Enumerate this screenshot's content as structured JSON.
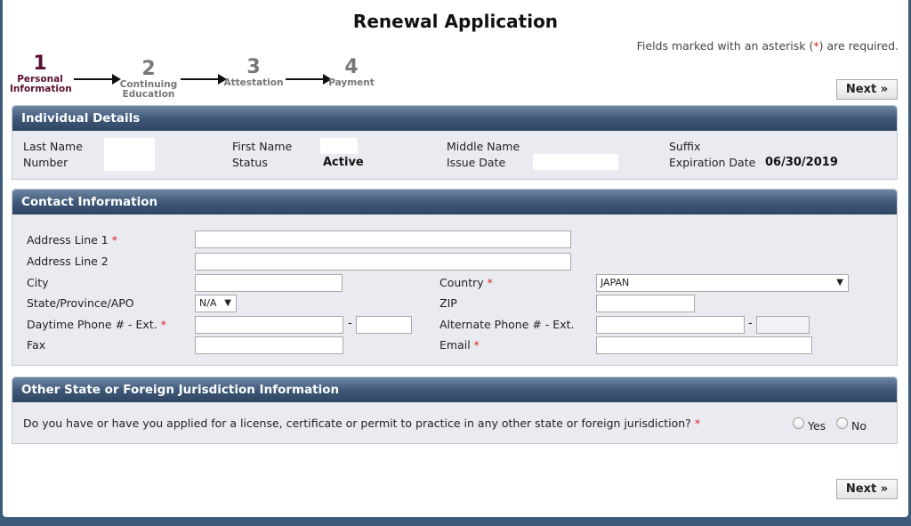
{
  "page": {
    "title": "Renewal Application",
    "required_note_pre": "Fields marked with an asterisk (",
    "required_note_star": "*",
    "required_note_post": ") are required."
  },
  "steps": [
    {
      "num": "1",
      "label_line1": "Personal",
      "label_line2": "Information",
      "active": true
    },
    {
      "num": "2",
      "label_line1": "Continuing",
      "label_line2": "Education",
      "active": false
    },
    {
      "num": "3",
      "label_line1": "Attestation",
      "label_line2": "",
      "active": false
    },
    {
      "num": "4",
      "label_line1": "Payment",
      "label_line2": "",
      "active": false
    }
  ],
  "next_button": "Next »",
  "individual": {
    "heading": "Individual Details",
    "last_name_label": "Last Name",
    "number_label": "Number",
    "first_name_label": "First Name",
    "status_label": "Status",
    "status_value": "Active",
    "middle_name_label": "Middle Name",
    "issue_date_label": "Issue Date",
    "suffix_label": "Suffix",
    "expiration_label": "Expiration Date",
    "expiration_value": "06/30/2019"
  },
  "contact": {
    "heading": "Contact Information",
    "address1_label": "Address Line 1",
    "address2_label": "Address Line 2",
    "city_label": "City",
    "state_label": "State/Province/APO",
    "state_value": "N/A",
    "day_phone_label": "Daytime Phone # - Ext.",
    "fax_label": "Fax",
    "country_label": "Country",
    "country_value": "JAPAN",
    "zip_label": "ZIP",
    "alt_phone_label": "Alternate Phone # - Ext.",
    "email_label": "Email",
    "required_star": "*",
    "dash": "-"
  },
  "other_state": {
    "heading": "Other State or Foreign Jurisdiction Information",
    "question": "Do you have or have you applied for a license, certificate or permit to practice in any other state or foreign jurisdiction?",
    "yes_label": "Yes",
    "no_label": "No"
  },
  "colors": {
    "section_header": "#3d5676",
    "active_step": "#5a1030",
    "required": "#dd2222"
  }
}
